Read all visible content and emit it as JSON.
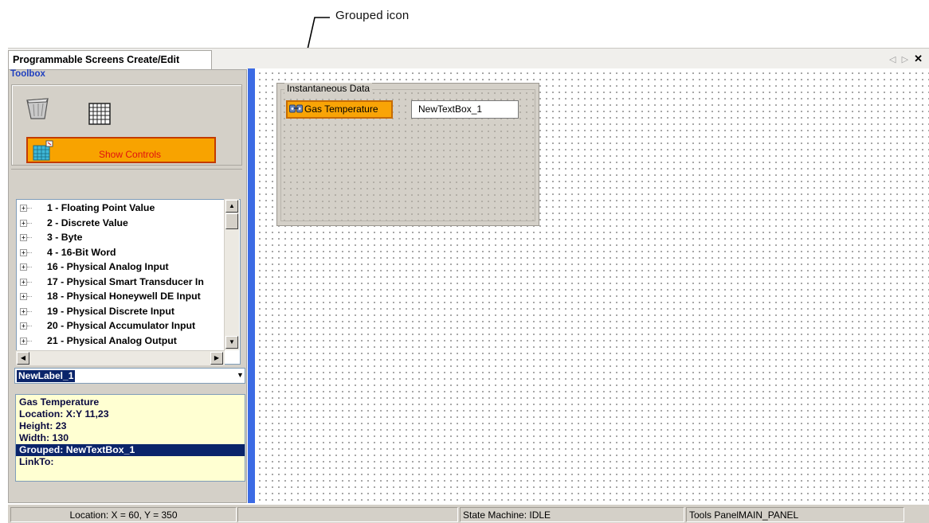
{
  "annotation": {
    "callout_label": "Grouped icon"
  },
  "window": {
    "tab_title": "Programmable Screens Create/Edit",
    "controls": {
      "arrows": "◁ ▷",
      "close": "✕"
    }
  },
  "toolbox": {
    "title": "Toolbox",
    "icons": [
      "trash-can-icon",
      "grid-icon"
    ],
    "show_controls_label": "Show Controls",
    "tree_items": [
      "1 - Floating Point Value",
      "2 - Discrete Value",
      "3 - Byte",
      "4 - 16-Bit Word",
      "16 - Physical Analog Input",
      "17 - Physical Smart Transducer In",
      "18 - Physical Honeywell DE Input",
      "19 - Physical Discrete Input",
      "20 - Physical Accumulator Input",
      "21 - Physical Analog Output"
    ],
    "selected_control": "NewLabel_1",
    "properties": [
      "Gas Temperature",
      "Location: X:Y 11,23",
      "Height: 23",
      "Width: 130",
      "Grouped: NewTextBox_1",
      "LinkTo:"
    ],
    "selected_property_index": 4
  },
  "canvas": {
    "groupbox_title": "Instantaneous Data",
    "label_text": "Gas Temperature",
    "textbox_text": "NewTextBox_1"
  },
  "status": {
    "location": "Location: X = 60, Y = 350",
    "state": "State Machine: IDLE",
    "panel": "Tools PanelMAIN_PANEL"
  },
  "colors": {
    "show_controls_bg": "#f8a300",
    "splitter": "#3c6be4",
    "selection": "#0a246a",
    "properties_bg": "#ffffd2",
    "label_bg": "#f9a406"
  }
}
